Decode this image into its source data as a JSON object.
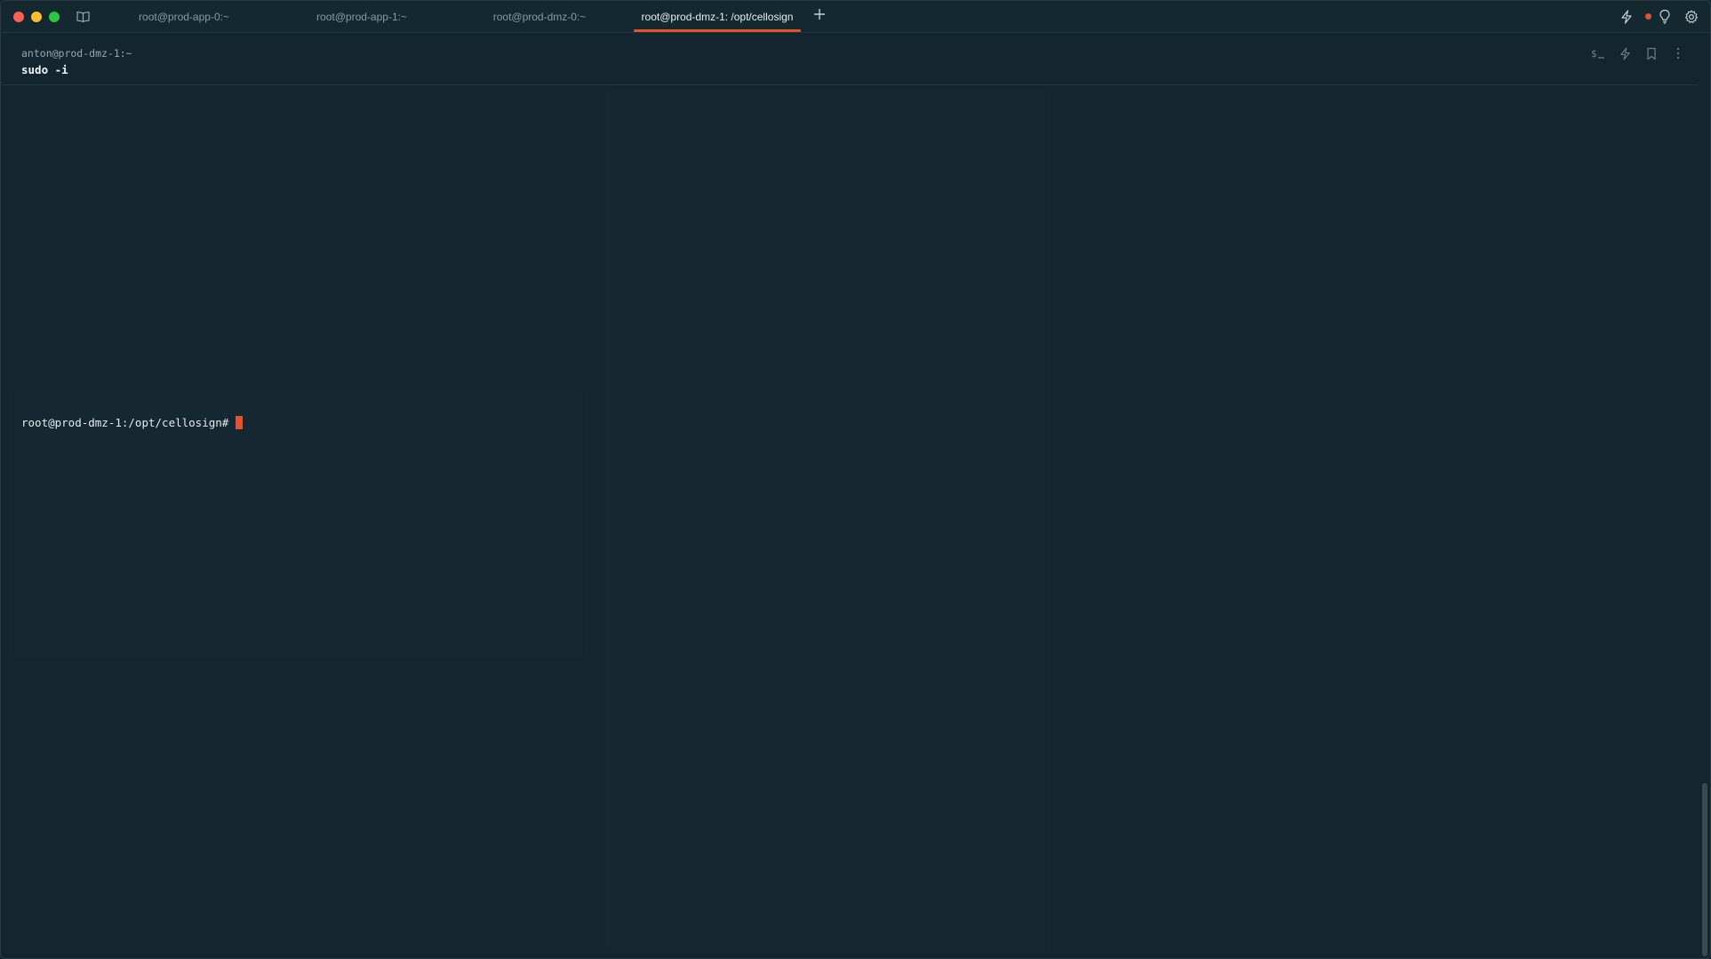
{
  "tabs": [
    {
      "label": "root@prod-app-0:~",
      "active": false
    },
    {
      "label": "root@prod-app-1:~",
      "active": false
    },
    {
      "label": "root@prod-dmz-0:~",
      "active": false
    },
    {
      "label": "root@prod-dmz-1: /opt/cellosign",
      "active": true
    }
  ],
  "block": {
    "context": "anton@prod-dmz-1:~",
    "command": "sudo -i"
  },
  "prompt": {
    "text": "root@prod-dmz-1:/opt/cellosign#"
  },
  "colors": {
    "background": "#13262f",
    "accent": "#e2542f",
    "text": "#e5ecee",
    "muted": "#8b9aa1"
  },
  "icons": {
    "sidebar_toggle": "book-icon",
    "new_tab": "plus-icon",
    "workflows": "lightning-icon",
    "recording": "record-dot-icon",
    "hints": "lightbulb-icon",
    "settings": "gear-icon",
    "block_terminal": "terminal-prompt-icon",
    "block_workflow": "lightning-icon",
    "block_bookmark": "bookmark-icon",
    "block_more": "more-vertical-icon"
  }
}
